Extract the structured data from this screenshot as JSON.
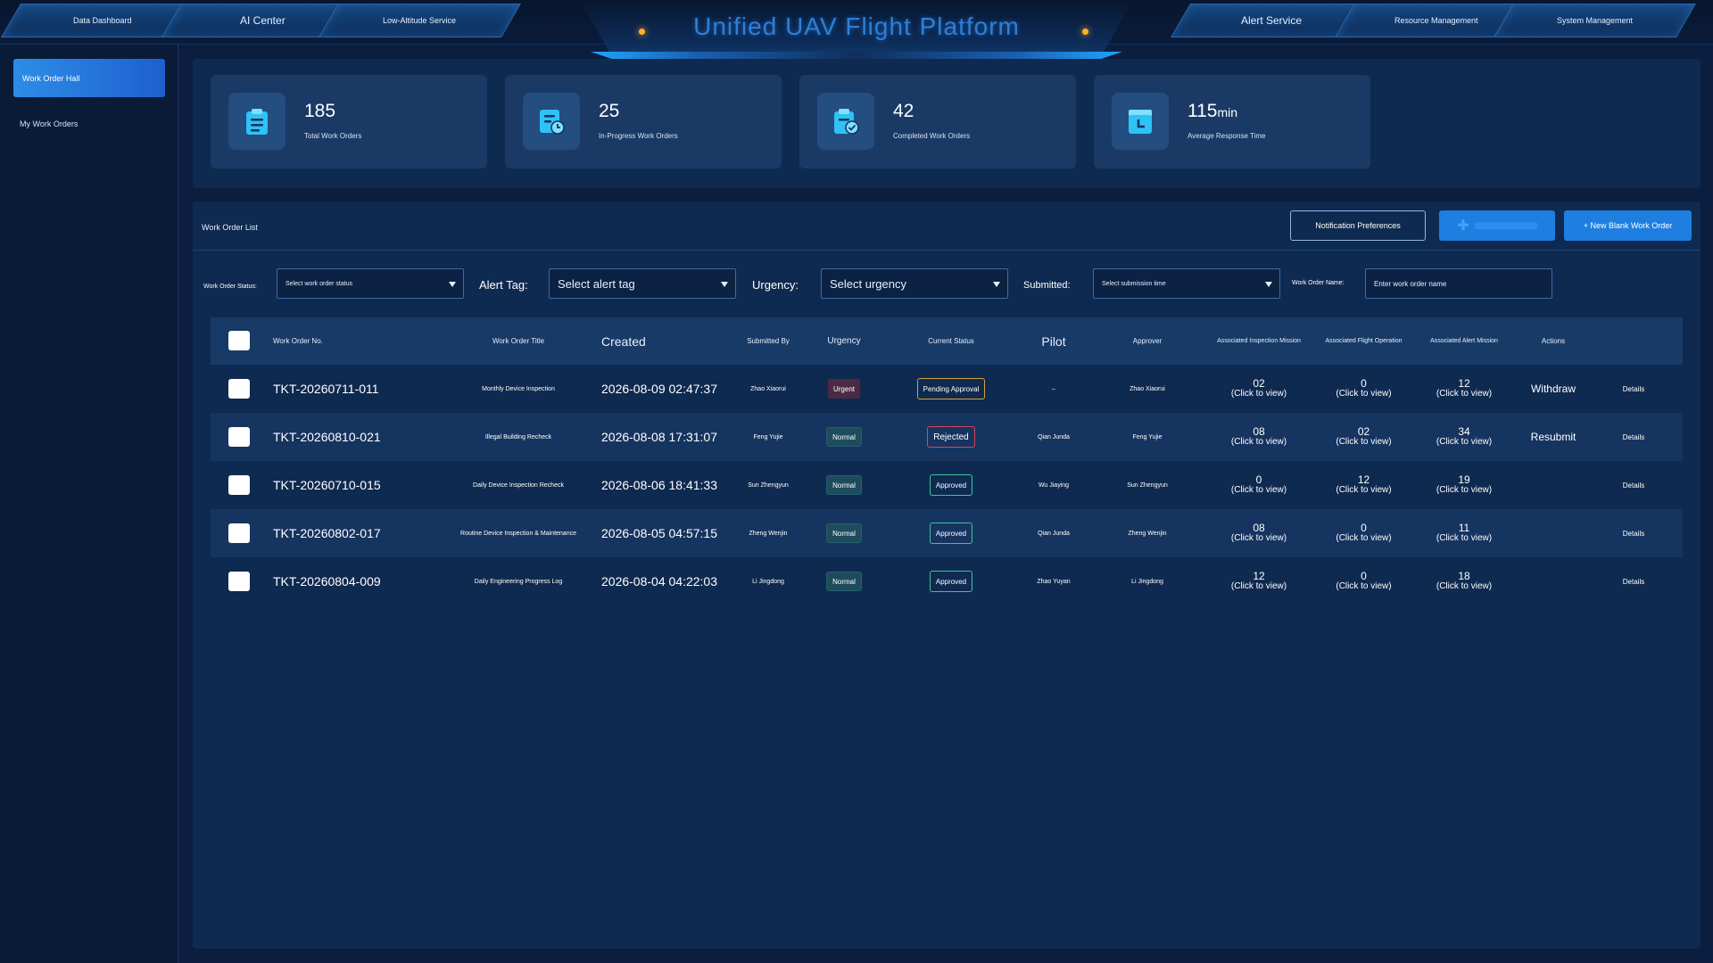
{
  "nav": {
    "left_tabs": [
      "Data Dashboard",
      "AI Center",
      "Low-Altitude Service"
    ],
    "right_tabs": [
      "Alert Service",
      "Resource Management",
      "System Management"
    ],
    "title": "Unified UAV Flight Platform"
  },
  "sidebar": {
    "items": [
      {
        "label": "Work Order Hall",
        "active": true
      },
      {
        "label": "My Work Orders",
        "active": false
      }
    ]
  },
  "stats": [
    {
      "value": "185",
      "unit": "",
      "label": "Total Work Orders",
      "icon": "clipboard-list-icon"
    },
    {
      "value": "25",
      "unit": "",
      "label": "In-Progress Work Orders",
      "icon": "document-clock-icon"
    },
    {
      "value": "42",
      "unit": "",
      "label": "Completed Work Orders",
      "icon": "clipboard-check-icon"
    },
    {
      "value": "115",
      "unit": "min",
      "label": "Average Response Time",
      "icon": "timer-icon"
    }
  ],
  "list": {
    "title": "Work Order List",
    "buttons": {
      "notification": "Notification Preferences",
      "new_blank": "+ New Blank Work Order"
    },
    "filters": {
      "status_label": "Work Order Status:",
      "status_placeholder": "Select work order status",
      "alert_label": "Alert Tag:",
      "alert_placeholder": "Select alert tag",
      "urgency_label": "Urgency:",
      "urgency_placeholder": "Select urgency",
      "submitted_label": "Submitted:",
      "submitted_placeholder": "Select submission time",
      "name_label": "Work Order Name:",
      "name_placeholder": "Enter work order name"
    },
    "columns": {
      "no": "Work Order No.",
      "title": "Work Order Title",
      "created": "Created",
      "submitted_by": "Submitted By",
      "urgency": "Urgency",
      "status": "Current Status",
      "pilot": "Pilot",
      "approver": "Approver",
      "inspection": "Associated Inspection Mission",
      "flight": "Associated Flight Operation",
      "alert": "Associated Alert Mission",
      "actions": "Actions"
    },
    "rows": [
      {
        "no": "TKT-20260711-011",
        "title": "Monthly Device Inspection",
        "created": "2026-08-09 02:47:37",
        "submitted_by": "Zhao Xiaorui",
        "urgency": "Urgent",
        "status": "Pending Approval",
        "status_kind": "pending",
        "pilot": "–",
        "approver": "Zhao Xiaorui",
        "inspection": "02",
        "flight": "0",
        "alert": "12",
        "action": "Withdraw",
        "details": "Details"
      },
      {
        "no": "TKT-20260810-021",
        "title": "Illegal Building Recheck",
        "created": "2026-08-08 17:31:07",
        "submitted_by": "Feng Yujie",
        "urgency": "Normal",
        "status": "Rejected",
        "status_kind": "rejected",
        "pilot": "Qian Junda",
        "approver": "Feng Yujie",
        "inspection": "08",
        "flight": "02",
        "alert": "34",
        "action": "Resubmit",
        "details": "Details"
      },
      {
        "no": "TKT-20260710-015",
        "title": "Daily Device Inspection Recheck",
        "created": "2026-08-06 18:41:33",
        "submitted_by": "Sun Zhengyun",
        "urgency": "Normal",
        "status": "Approved",
        "status_kind": "approved",
        "pilot": "Wu Jiaying",
        "approver": "Sun Zhengyun",
        "inspection": "0",
        "flight": "12",
        "alert": "19",
        "action": "",
        "details": "Details"
      },
      {
        "no": "TKT-20260802-017",
        "title": "Routine Device Inspection & Maintenance",
        "created": "2026-08-05 04:57:15",
        "submitted_by": "Zheng Wenjin",
        "urgency": "Normal",
        "status": "Approved",
        "status_kind": "approved",
        "pilot": "Qian Junda",
        "approver": "Zheng Wenjin",
        "inspection": "08",
        "flight": "0",
        "alert": "11",
        "action": "",
        "details": "Details"
      },
      {
        "no": "TKT-20260804-009",
        "title": "Daily Engineering Progress Log",
        "created": "2026-08-04 04:22:03",
        "submitted_by": "Li Jingdong",
        "urgency": "Normal",
        "status": "Approved",
        "status_kind": "approved",
        "pilot": "Zhao Yuyan",
        "approver": "Li Jingdong",
        "inspection": "12",
        "flight": "0",
        "alert": "18",
        "action": "",
        "details": "Details"
      }
    ],
    "click_hint": "(Click to view)"
  },
  "colors": {
    "background": "#0b1e3f",
    "panel": "#0f2a50",
    "accent": "#1e7fe0",
    "urgent": "#4a2a44",
    "approved": "#3ec49a",
    "rejected": "#d9465b",
    "pending": "#d4a23c"
  }
}
